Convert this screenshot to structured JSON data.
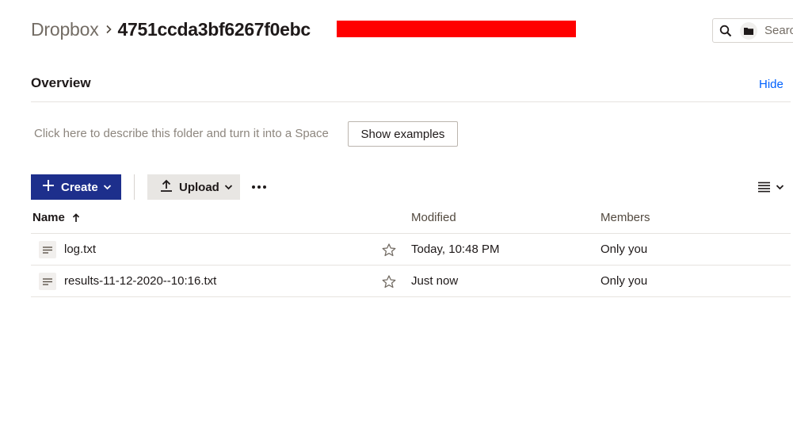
{
  "breadcrumb": {
    "root": "Dropbox",
    "current": "4751ccda3bf6267f0ebc"
  },
  "search": {
    "placeholder": "Search"
  },
  "overview": {
    "title": "Overview",
    "hide_label": "Hide",
    "describe_text": "Click here to describe this folder and turn it into a Space",
    "show_examples_label": "Show examples"
  },
  "toolbar": {
    "create_label": "Create",
    "upload_label": "Upload"
  },
  "table": {
    "headers": {
      "name": "Name",
      "modified": "Modified",
      "members": "Members"
    },
    "rows": [
      {
        "name": "log.txt",
        "modified": "Today, 10:48 PM",
        "members": "Only you"
      },
      {
        "name": "results-11-12-2020--10:16.txt",
        "modified": "Just now",
        "members": "Only you"
      }
    ]
  },
  "colors": {
    "accent": "#1d2f8c",
    "link": "#0061fe",
    "redaction": "#ff0000"
  },
  "icons": [
    "chevron-right-icon",
    "search-icon",
    "folder-icon",
    "plus-icon",
    "chevron-down-icon",
    "upload-icon",
    "more-icon",
    "list-view-icon",
    "sort-up-arrow-icon",
    "text-file-icon",
    "star-icon"
  ]
}
